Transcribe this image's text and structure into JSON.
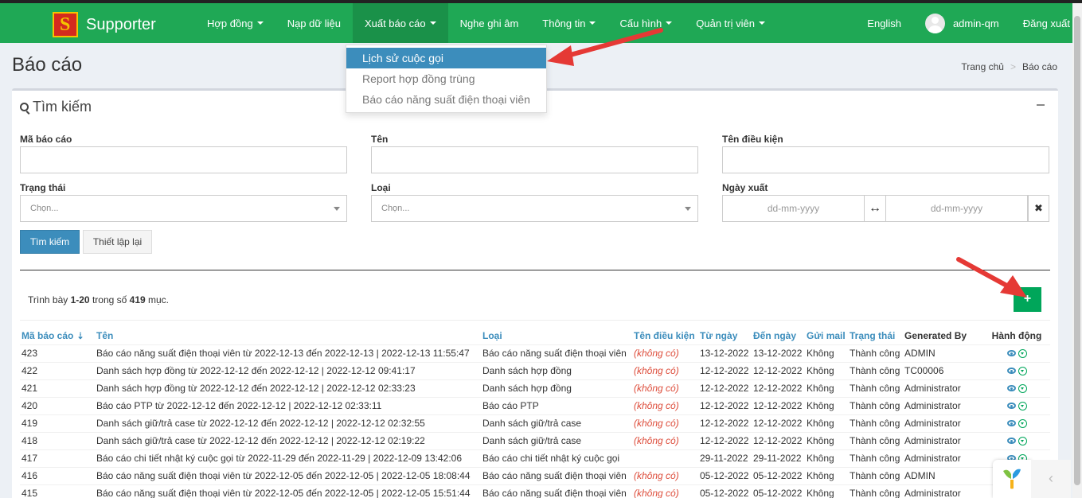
{
  "app": {
    "name": "Supporter"
  },
  "navbar": {
    "items": [
      {
        "label": "Hợp đồng",
        "caret": true
      },
      {
        "label": "Nạp dữ liệu",
        "caret": false
      },
      {
        "label": "Xuất báo cáo",
        "caret": true,
        "active": true
      },
      {
        "label": "Nghe ghi âm",
        "caret": false
      },
      {
        "label": "Thông tin",
        "caret": true
      },
      {
        "label": "Cấu hình",
        "caret": true
      },
      {
        "label": "Quản trị viên",
        "caret": true
      }
    ],
    "language": "English",
    "user": "admin-qm",
    "logout": "Đăng xuất"
  },
  "dropdown": {
    "items": [
      {
        "label": "Lịch sử cuộc gọi",
        "active": true
      },
      {
        "label": "Report hợp đồng trùng",
        "active": false
      },
      {
        "label": "Báo cáo năng suất điện thoại viên",
        "active": false
      }
    ]
  },
  "page": {
    "title": "Báo cáo",
    "breadcrumb": [
      "Trang chủ",
      "Báo cáo"
    ]
  },
  "search": {
    "title": "Tìm kiếm",
    "fields": {
      "code_label": "Mã báo cáo",
      "name_label": "Tên",
      "condition_label": "Tên điều kiện",
      "status_label": "Trạng thái",
      "status_placeholder": "Chọn...",
      "type_label": "Loại",
      "type_placeholder": "Chọn...",
      "date_label": "Ngày xuất",
      "date_from_placeholder": "dd-mm-yyyy",
      "date_to_placeholder": "dd-mm-yyyy",
      "range_symbol": "↔",
      "clear_symbol": "✖"
    },
    "search_button": "Tìm kiếm",
    "reset_button": "Thiết lập lại"
  },
  "summary": {
    "prefix": "Trình bày ",
    "range": "1-20",
    "middle": " trong số ",
    "total": "419",
    "suffix": " mục."
  },
  "add_button": "+",
  "table": {
    "columns": [
      "Mã báo cáo",
      "Tên",
      "Loại",
      "Tên điều kiện",
      "Từ ngày",
      "Đến ngày",
      "Gửi mail",
      "Trạng thái",
      "Generated By",
      "Hành động"
    ],
    "rows": [
      [
        "423",
        "Báo cáo năng suất điện thoại viên từ 2022-12-13 đến 2022-12-13 | 2022-12-13 11:55:47",
        "Báo cáo năng suất điện thoại viên",
        "(không có)",
        "13-12-2022",
        "13-12-2022",
        "Không",
        "Thành công",
        "ADMIN"
      ],
      [
        "422",
        "Danh sách hợp đồng từ 2022-12-12 đến 2022-12-12 | 2022-12-12 09:41:17",
        "Danh sách hợp đồng",
        "(không có)",
        "12-12-2022",
        "12-12-2022",
        "Không",
        "Thành công",
        "TC00006"
      ],
      [
        "421",
        "Danh sách hợp đồng từ 2022-12-12 đến 2022-12-12 | 2022-12-12 02:33:23",
        "Danh sách hợp đồng",
        "(không có)",
        "12-12-2022",
        "12-12-2022",
        "Không",
        "Thành công",
        "Administrator"
      ],
      [
        "420",
        "Báo cáo PTP từ 2022-12-12 đến 2022-12-12 | 2022-12-12 02:33:11",
        "Báo cáo PTP",
        "(không có)",
        "12-12-2022",
        "12-12-2022",
        "Không",
        "Thành công",
        "Administrator"
      ],
      [
        "419",
        "Danh sách giữ/trả case từ 2022-12-12 đến 2022-12-12 | 2022-12-12 02:32:55",
        "Danh sách giữ/trả case",
        "(không có)",
        "12-12-2022",
        "12-12-2022",
        "Không",
        "Thành công",
        "Administrator"
      ],
      [
        "418",
        "Danh sách giữ/trả case từ 2022-12-12 đến 2022-12-12 | 2022-12-12 02:19:22",
        "Danh sách giữ/trả case",
        "(không có)",
        "12-12-2022",
        "12-12-2022",
        "Không",
        "Thành công",
        "Administrator"
      ],
      [
        "417",
        "Báo cáo chi tiết nhật ký cuộc gọi từ 2022-11-29 đến 2022-11-29 | 2022-12-09 13:42:06",
        "Báo cáo chi tiết nhật ký cuộc gọi",
        "",
        "29-11-2022",
        "29-11-2022",
        "Không",
        "Thành công",
        "Administrator"
      ],
      [
        "416",
        "Báo cáo năng suất điện thoại viên từ 2022-12-05 đến 2022-12-05 | 2022-12-05 18:08:44",
        "Báo cáo năng suất điện thoại viên",
        "(không có)",
        "05-12-2022",
        "05-12-2022",
        "Không",
        "Thành công",
        "ADMIN"
      ],
      [
        "415",
        "Báo cáo năng suất điện thoại viên từ 2022-12-05 đến 2022-12-05 | 2022-12-05 15:51:44",
        "Báo cáo năng suất điện thoại viên",
        "(không có)",
        "05-12-2022",
        "05-12-2022",
        "Không",
        "Thành công",
        "Administrator"
      ]
    ]
  },
  "colors": {
    "navbar": "#1fa855",
    "primary": "#3c8dbc",
    "success": "#00a65a",
    "arrow": "#e53935"
  },
  "icons": [
    "search-icon",
    "collapse-icon",
    "sort-desc-icon",
    "eye-icon",
    "download-icon",
    "caret-down-icon",
    "avatar-icon",
    "chevron-left-icon"
  ]
}
